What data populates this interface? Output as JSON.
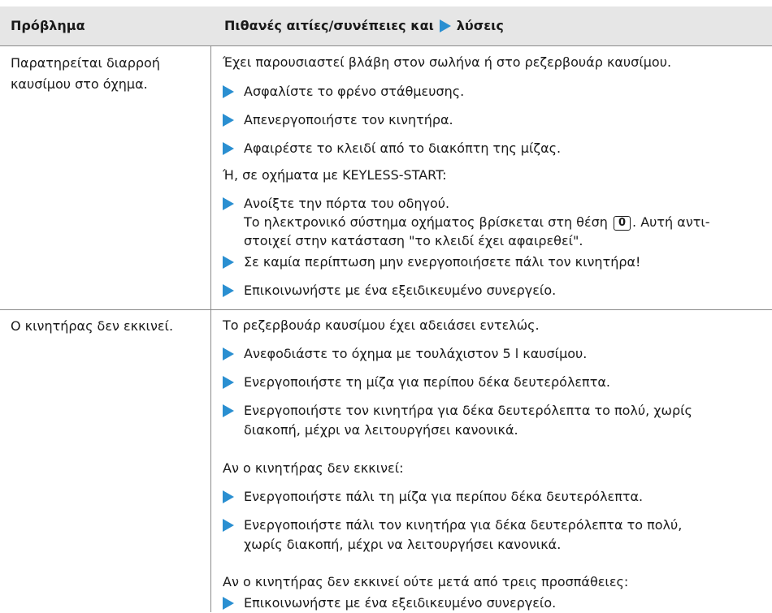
{
  "header": {
    "col1": "Πρόβλημα",
    "col2_before": "Πιθανές αιτίες/συνέπειες και",
    "col2_after": "λύσεις"
  },
  "rows": [
    {
      "problem": "Παρατηρείται διαρροή καυσίμου στο όχημα.",
      "cause": "Έχει παρουσιαστεί βλάβη στον σωλήνα ή στο ρεζερβουάρ καυσίμου.",
      "steps1": [
        "Ασφαλίστε το φρένο στάθμευσης.",
        "Απενεργοποιήστε τον κινητήρα.",
        "Αφαιρέστε το κλειδί από το διακόπτη της μίζας."
      ],
      "alt": "Ή, σε οχήματα με KEYLESS-START:",
      "step_door": "Ανοίξτε την πόρτα του οδηγού.",
      "note_part1": "Το ηλεκτρονικό σύστημα οχήματος βρίσκεται στη θέση",
      "note_key": "0",
      "note_part2": ". Αυτή αντι-",
      "note_line2": "στοιχεί στην κατάσταση \"το κλειδί έχει αφαιρεθεί\".",
      "steps2": [
        "Σε καμία περίπτωση μην ενεργοποιήσετε πάλι τον κινητήρα!",
        "Επικοινωνήστε με ένα εξειδικευμένο συνεργείο."
      ]
    },
    {
      "problem": "Ο κινητήρας δεν εκκινεί.",
      "cause": "Το ρεζερβουάρ καυσίμου έχει αδειάσει εντελώς.",
      "steps1": [
        "Ανεφοδιάστε το όχημα με τουλάχιστον 5 l καυσίμου.",
        "Ενεργοποιήστε τη μίζα για περίπου δέκα δευτερόλεπτα."
      ],
      "step3_line1": "Ενεργοποιήστε τον κινητήρα για δέκα δευτερόλεπτα το πολύ, χωρίς",
      "step3_line2": "διακοπή, μέχρι να λειτουργήσει κανονικά.",
      "if_no_start": "Αν ο κινητήρας δεν εκκινεί:",
      "step4": "Ενεργοποιήστε πάλι τη μίζα για περίπου δέκα δευτερόλεπτα.",
      "step5_line1": "Ενεργοποιήστε πάλι τον κινητήρα για δέκα δευτερόλεπτα το πολύ,",
      "step5_line2": "χωρίς διακοπή, μέχρι να λειτουργήσει κανονικά.",
      "if_three": "Αν ο κινητήρας δεν εκκινεί ούτε μετά από τρεις προσπάθειες:",
      "step6": "Επικοινωνήστε με ένα εξειδικευμένο συνεργείο."
    }
  ]
}
